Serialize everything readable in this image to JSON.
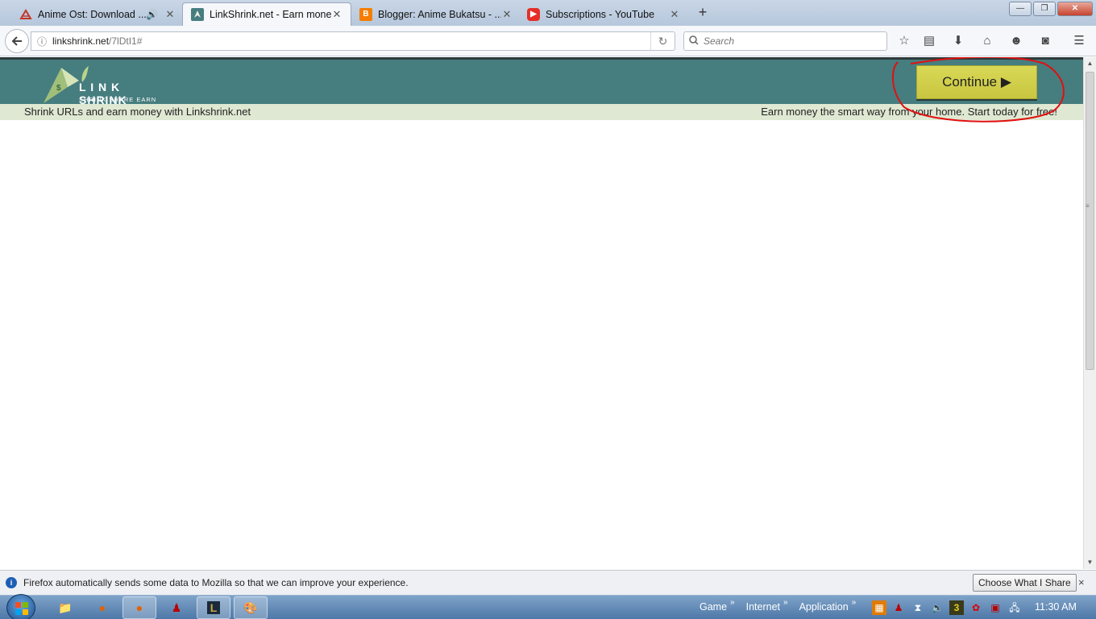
{
  "browser": {
    "tabs": [
      {
        "title": "Anime Ost: Download ...",
        "active": false,
        "has_sound": true,
        "favicon": "anime-ost-favicon"
      },
      {
        "title": "LinkShrink.net - Earn mone...",
        "active": true,
        "has_sound": false,
        "favicon": "linkshrink-favicon"
      },
      {
        "title": "Blogger: Anime Bukatsu - ...",
        "active": false,
        "has_sound": false,
        "favicon": "blogger-favicon"
      },
      {
        "title": "Subscriptions - YouTube",
        "active": false,
        "has_sound": false,
        "favicon": "youtube-favicon"
      }
    ],
    "new_tab": "+",
    "url_domain": "linkshrink.net",
    "url_path": "/7lDtI1#",
    "search_placeholder": "Search"
  },
  "site": {
    "logo_text": "L I N K SHRINK",
    "logo_tagline": "SHRINK  SHARE  EARN",
    "continue_label": "Continue ▶",
    "tagline_left": "Shrink URLs and earn money with Linkshrink.net",
    "tagline_right": "Earn money the smart way from your home. Start today for free!"
  },
  "notification": {
    "text": "Firefox automatically sends some data to Mozilla so that we can improve your experience.",
    "button": "Choose What I Share",
    "close": "×"
  },
  "taskbar": {
    "toolbar_labels": [
      "Game",
      "Internet",
      "Application"
    ],
    "clock": "11:30 AM"
  },
  "colors": {
    "site_header": "#467d7f",
    "continue_button": "#d4d34f",
    "substrip": "#dfe8d2",
    "annotation": "#e01010"
  }
}
